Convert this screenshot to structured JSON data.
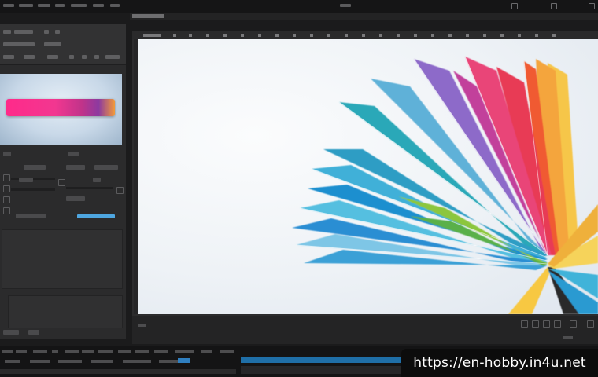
{
  "watermark": {
    "url": "https://en-hobby.in4u.net"
  },
  "colors": {
    "accent_blue": "#4ea6e0",
    "timeline_blue": "#2f7fc0",
    "panel_dark": "#2b2b2c"
  },
  "icons": {
    "minimize": "minimize-icon",
    "maximize": "maximize-icon",
    "close": "close-icon"
  }
}
